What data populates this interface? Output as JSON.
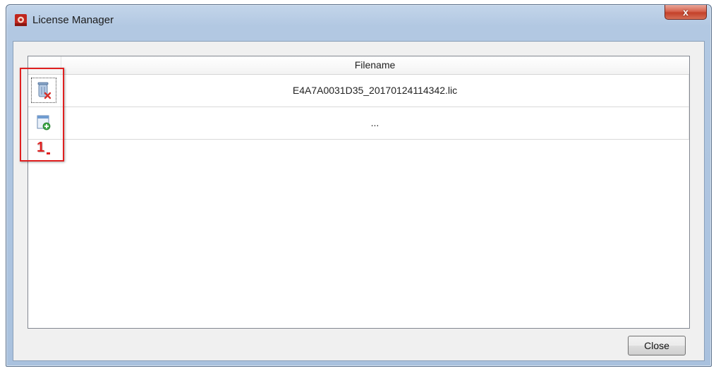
{
  "window": {
    "title": "License Manager",
    "close_glyph": "x"
  },
  "table": {
    "columns": [
      "Filename"
    ],
    "rows": [
      {
        "icon": "delete-license-icon",
        "filename": "E4A7A0031D35_20170124114342.lic"
      },
      {
        "icon": "add-license-icon",
        "filename": "..."
      }
    ]
  },
  "annotation": {
    "number": "1",
    "color": "#e02020"
  },
  "footer": {
    "close_label": "Close"
  }
}
